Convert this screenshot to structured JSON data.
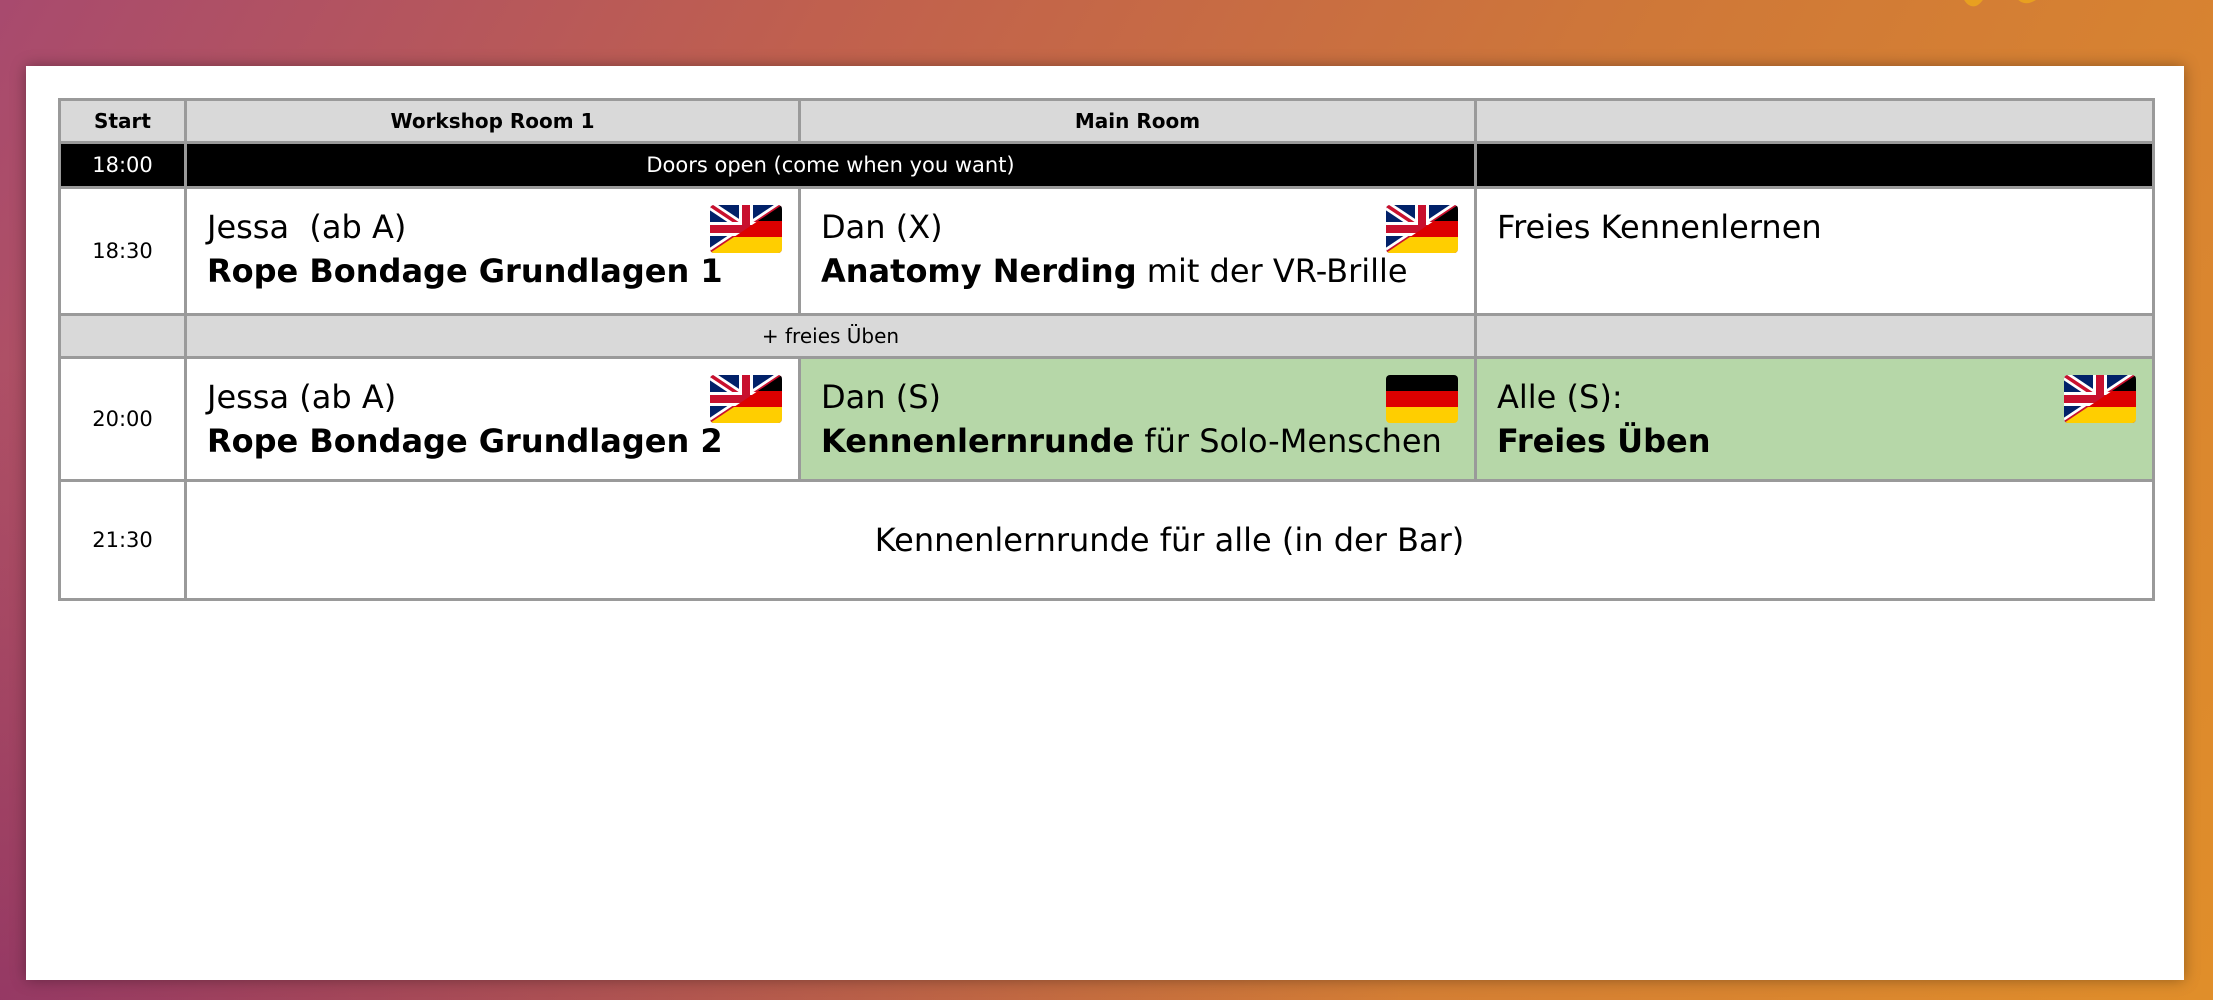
{
  "header": {
    "col_start": "Start",
    "col_room1": "Workshop Room 1",
    "col_main": "Main Room",
    "col_third": ""
  },
  "rows": {
    "doors": {
      "time": "18:00",
      "text": "Doors open (come when you want)"
    },
    "slot1": {
      "time": "18:30",
      "room1": {
        "speaker": "Jessa  (ab A)",
        "title_bold": "Rope Bondage Grundlagen 1",
        "title_rest": "",
        "flag": "uk-de-flag-icon"
      },
      "main": {
        "speaker": "Dan (X)",
        "title_bold": "Anatomy Nerding",
        "title_rest": " mit der VR-Brille",
        "flag": "uk-de-flag-icon"
      },
      "third": {
        "text": "Freies Kennenlernen"
      }
    },
    "free": {
      "text": "+ freies Üben"
    },
    "slot2": {
      "time": "20:00",
      "room1": {
        "speaker": "Jessa (ab A)",
        "title_bold": "Rope Bondage Grundlagen 2",
        "title_rest": "",
        "flag": "uk-de-flag-icon"
      },
      "main": {
        "speaker": "Dan (S)",
        "title_bold": "Kennenlernrunde",
        "title_rest": " für Solo-Menschen",
        "flag": "de-flag-icon"
      },
      "third": {
        "speaker": "Alle (S):",
        "title_bold": "Freies Üben",
        "title_rest": "",
        "flag": "uk-de-flag-icon"
      }
    },
    "final": {
      "time": "21:30",
      "text": "Kennenlernrunde für alle (in der Bar)"
    }
  },
  "colors": {
    "header_bg": "#d9d9d9",
    "doors_bg": "#000000",
    "highlight_green": "#b6d7a8",
    "border": "#9a9a9a"
  }
}
